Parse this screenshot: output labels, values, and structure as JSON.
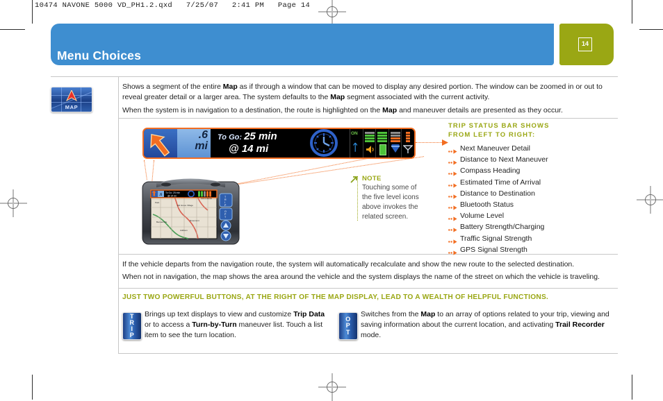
{
  "slug": "10474 NAVONE 5000 VD_PH1.2.qxd   7/25/07   2:41 PM   Page 14",
  "header": {
    "title": "Menu Choices",
    "page_number": "14",
    "band_color": "#3e8ed0",
    "badge_color": "#9aa714"
  },
  "map_icon": {
    "label": "MAP"
  },
  "intro": {
    "p1_a": "Shows a segment of the entire ",
    "p1_b": "Map",
    "p1_c": " as if through a window that can be moved to display any desired portion. The window can be zoomed in or out to reveal greater detail or a larger area. The system defaults to the ",
    "p1_d": "Map",
    "p1_e": " segment associated with the current activity.",
    "p2_a": "When the system is in navigation to a destination, the route is highlighted on the ",
    "p2_b": "Map",
    "p2_c": " and maneuver details are presented as they occur."
  },
  "status_bar": {
    "distance_value": ".6",
    "distance_unit": "mi",
    "togo_label": "To Go:",
    "togo_time": "25 min",
    "togo_at": "@",
    "togo_distance": "14 mi",
    "bluetooth_on": "ON",
    "border_color": "#f26d21"
  },
  "note": {
    "heading": "NOTE",
    "text": "Touching some of the five level icons above invokes the related screen."
  },
  "trip_status": {
    "heading_line1": "TRIP STATUS BAR SHOWS",
    "heading_line2": "FROM LEFT TO RIGHT:",
    "items": [
      "Next Maneuver Detail",
      "Distance to Next Maneuver",
      "Compass Heading",
      "Estimated Time of Arrival",
      "Distance to Destination",
      "Bluetooth Status",
      "Volume Level",
      "Battery Strength/Charging",
      "Traffic Signal Strength",
      "GPS Signal Strength"
    ],
    "accent_color": "#9aa714",
    "bullet_color": "#f26d21"
  },
  "outro": {
    "p1": "If the vehicle departs from the navigation route, the system will automatically recalculate and show the new route to the selected destination.",
    "p2": "When not in navigation, the map shows the area around the vehicle and the system displays the name of the street on which the vehicle is traveling."
  },
  "callout": "JUST TWO POWERFUL BUTTONS, AT THE RIGHT OF THE MAP DISPLAY, LEAD TO A WEALTH OF HELPFUL FUNCTIONS.",
  "buttons": {
    "trip": {
      "label_chars": [
        "T",
        "R",
        "I",
        "P"
      ],
      "t1_a": "Brings up text displays to view and customize ",
      "t1_b": "Trip Data",
      "t1_c": " or to access a ",
      "t1_d": "Turn-by-Turn",
      "t1_e": " maneuver list. Touch a list item to see the turn location."
    },
    "opt": {
      "label_chars": [
        "O",
        "P",
        "T"
      ],
      "t1_a": "Switches from the ",
      "t1_b": "Map",
      "t1_c": " to an array of options related to your trip, viewing and saving information about the current location, and activating ",
      "t1_d": "Trail Recorder",
      "t1_e": " mode."
    }
  }
}
